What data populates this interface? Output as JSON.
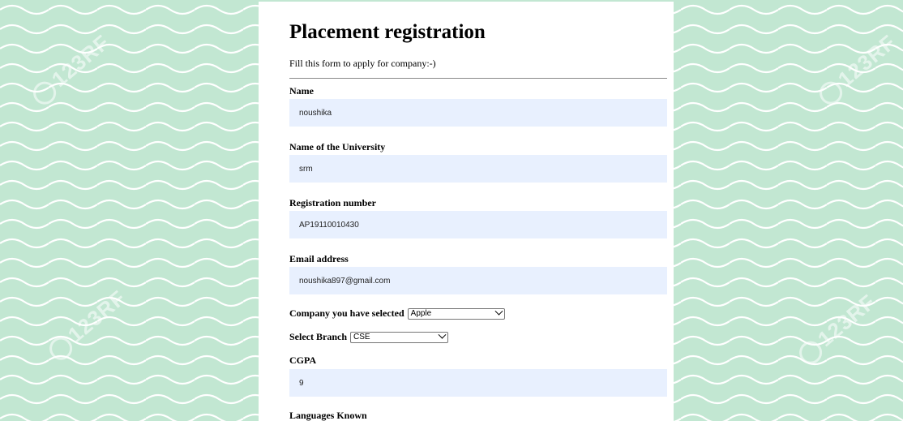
{
  "page": {
    "title": "Placement registration",
    "intro": "Fill this form to apply for company:-)",
    "background_color": "#c2e7d2",
    "input_background": "#e8f0fe",
    "watermark_text": "123RF"
  },
  "fields": {
    "name": {
      "label": "Name",
      "value": "noushika"
    },
    "university": {
      "label": "Name of the University",
      "value": "srm"
    },
    "registration": {
      "label": "Registration number",
      "value": "AP19110010430"
    },
    "email": {
      "label": "Email address",
      "value": "noushika897@gmail.com"
    },
    "company": {
      "label": "Company you have selected",
      "selected": "Apple"
    },
    "branch": {
      "label": "Select Branch",
      "selected": "CSE"
    },
    "cgpa": {
      "label": "CGPA",
      "value": "9"
    },
    "languages": {
      "label": "Languages Known"
    }
  },
  "icons": {
    "dropdown": "chevron-down-icon"
  }
}
